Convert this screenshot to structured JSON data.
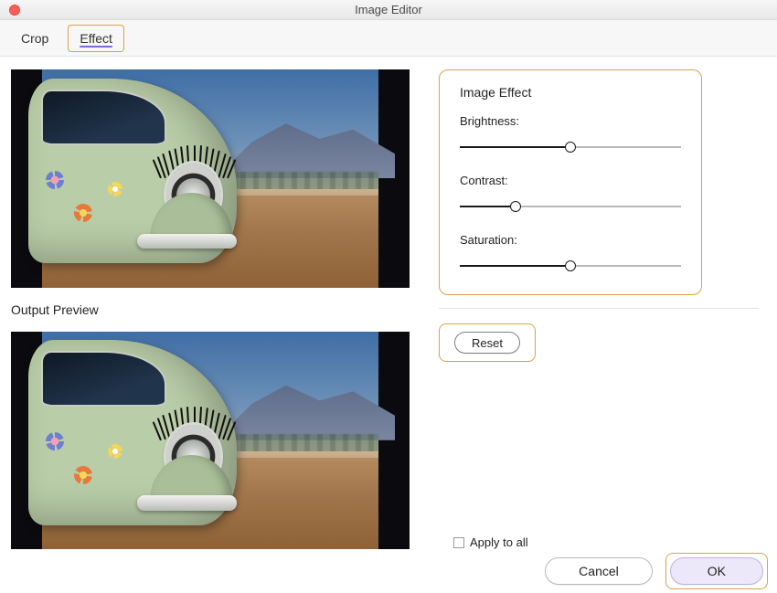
{
  "titlebar": {
    "title": "Image Editor"
  },
  "tabs": {
    "crop": "Crop",
    "effect": "Effect"
  },
  "preview_label": "Output Preview",
  "effects": {
    "title": "Image Effect",
    "brightness": {
      "label": "Brightness:",
      "value": 50
    },
    "contrast": {
      "label": "Contrast:",
      "value": 25
    },
    "saturation": {
      "label": "Saturation:",
      "value": 50
    }
  },
  "buttons": {
    "reset": "Reset",
    "cancel": "Cancel",
    "ok": "OK"
  },
  "apply_all": {
    "label": "Apply to all",
    "checked": false
  }
}
